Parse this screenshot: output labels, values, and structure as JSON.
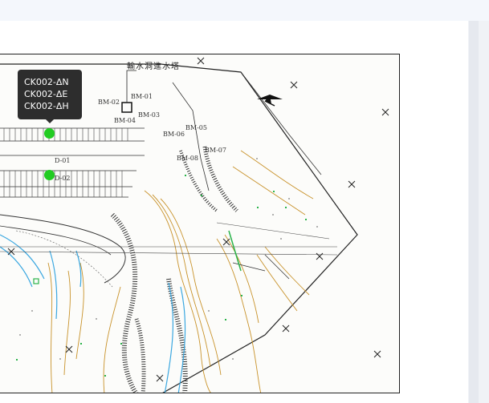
{
  "map": {
    "title": "輸水洞進水塔",
    "tooltip_lines": [
      "CK002-ΔN",
      "CK002-ΔE",
      "CK002-ΔH"
    ],
    "bm_labels": [
      "BM-01",
      "BM-02",
      "BM-03",
      "BM-04",
      "BM-05",
      "BM-06",
      "BM-07",
      "BM-08"
    ],
    "point_labels": [
      "D-01",
      "D-02"
    ],
    "marker_color": "#22cc22",
    "contour_color": "#c8922a",
    "water_color": "#3aa7e0"
  }
}
